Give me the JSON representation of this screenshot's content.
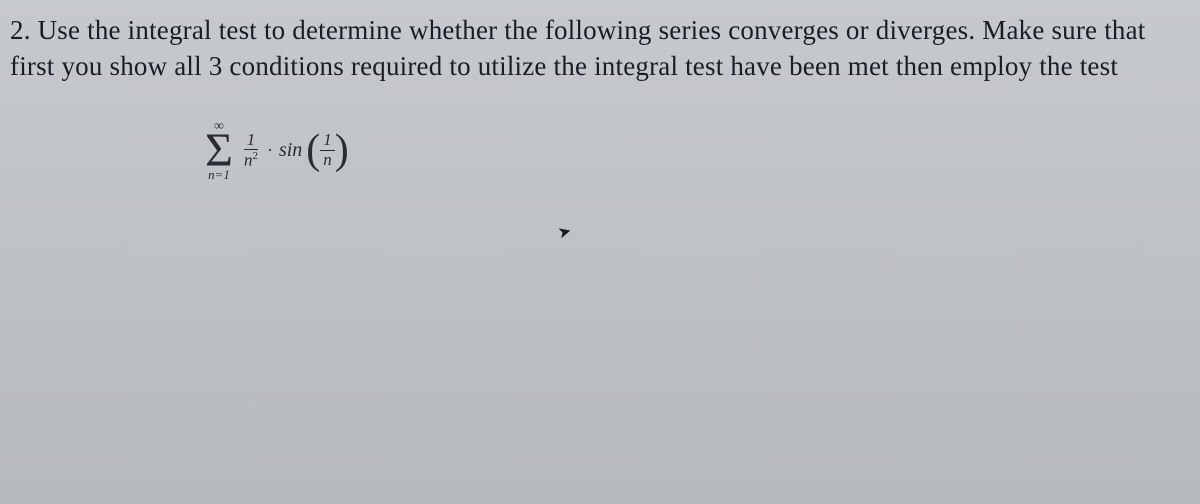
{
  "problem": {
    "number": "2.",
    "text": "Use the integral test to determine whether the following series converges or diverges.  Make sure that first you show all 3 conditions required to utilize the integral test have been met then employ the test"
  },
  "formula": {
    "sigma_upper": "∞",
    "sigma_lower": "n=1",
    "frac1_num": "1",
    "frac1_den_base": "n",
    "frac1_den_exp": "2",
    "operator": "·",
    "func": "sin",
    "frac2_num": "1",
    "frac2_den": "n"
  }
}
